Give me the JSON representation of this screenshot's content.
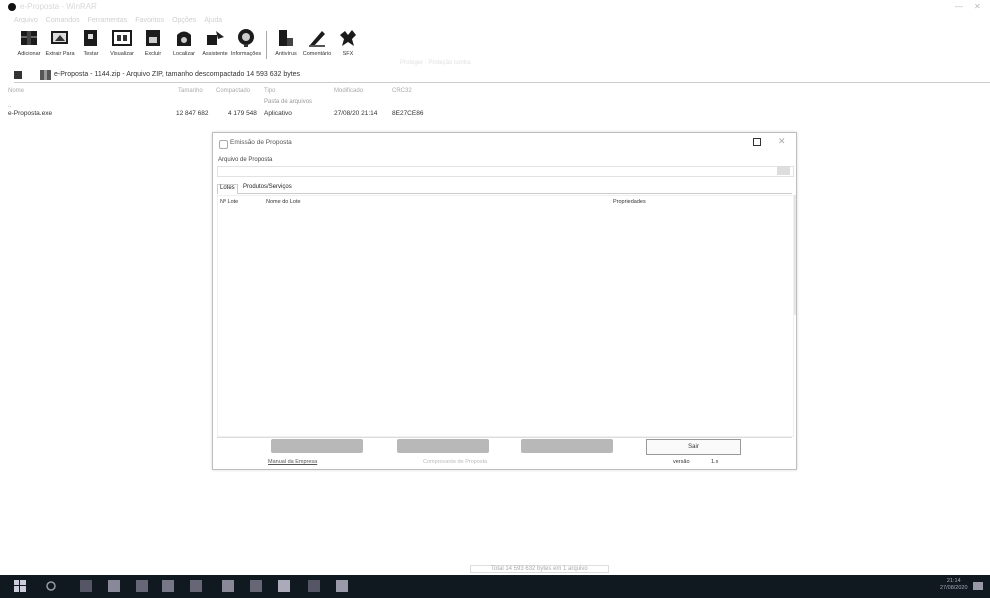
{
  "window": {
    "title": "e-Proposta - WinRAR",
    "minimize_glyph": "—",
    "close_glyph": "✕"
  },
  "menu": [
    "Arquivo",
    "Comandos",
    "Ferramentas",
    "Favoritos",
    "Opções",
    "Ajuda"
  ],
  "toolbar": {
    "buttons": [
      {
        "label": "Adicionar",
        "icon": "add-archive-icon"
      },
      {
        "label": "Extrair Para",
        "icon": "extract-icon"
      },
      {
        "label": "Testar",
        "icon": "test-icon"
      },
      {
        "label": "Visualizar",
        "icon": "view-icon"
      },
      {
        "label": "Excluir",
        "icon": "delete-icon"
      },
      {
        "label": "Localizar",
        "icon": "find-icon"
      },
      {
        "label": "Assistente",
        "icon": "wizard-icon"
      },
      {
        "label": "Informações",
        "icon": "info-icon"
      },
      {
        "label": "Antivírus",
        "icon": "antivirus-icon"
      },
      {
        "label": "Comentário",
        "icon": "comment-icon"
      },
      {
        "label": "SFX",
        "icon": "sfx-icon"
      }
    ],
    "faint_text": "Proteger · Proteção contra"
  },
  "addressbar": {
    "path": "e-Proposta - 1144.zip - Arquivo ZIP, tamanho descompactado 14 593 632 bytes"
  },
  "file_list": {
    "columns": [
      "Nome",
      "Tamanho",
      "Compactado",
      "Tipo",
      "Modificado",
      "CRC32"
    ],
    "parent_row": "..",
    "parent_type": "Pasta de arquivos",
    "rows": [
      {
        "name": "e-Proposta.exe",
        "size": "12 847 682",
        "packed": "4 179 548",
        "type": "Aplicativo",
        "modified": "27/08/20 21:14",
        "crc": "8E27CE86"
      }
    ]
  },
  "dialog": {
    "title": "Emissão de Proposta",
    "close_glyph": "✕",
    "file_label": "Arquivo de Proposta",
    "file_placeholder": "",
    "tabs": [
      "Lotes",
      "Produtos/Serviços"
    ],
    "table_headers": [
      "Nº Lote",
      "Nome do Lote",
      "Propriedades"
    ],
    "ok_label": "Sair",
    "link": "Manual da Empresa",
    "center_hint": "Comprovante de Proposta",
    "version_label": "versão",
    "version_value": "1.x"
  },
  "status": {
    "left": "",
    "center": "Total 14 593 632 bytes em 1 arquivo"
  },
  "taskbar": {
    "time": "21:14",
    "date": "27/08/2020"
  }
}
